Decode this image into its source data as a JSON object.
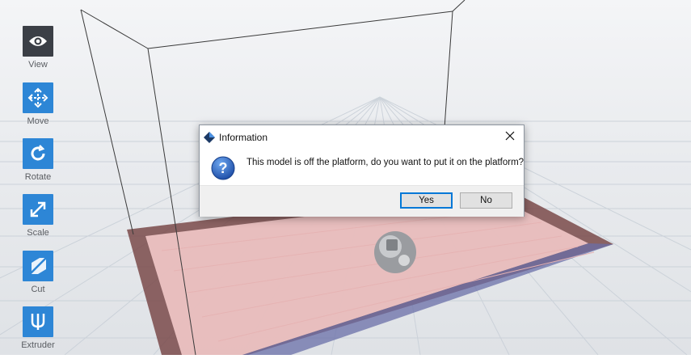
{
  "toolbar": {
    "items": [
      {
        "label": "View",
        "icon": "eye-icon",
        "active": true
      },
      {
        "label": "Move",
        "icon": "move-arrows-icon",
        "active": false
      },
      {
        "label": "Rotate",
        "icon": "rotate-icon",
        "active": false
      },
      {
        "label": "Scale",
        "icon": "scale-arrow-icon",
        "active": false
      },
      {
        "label": "Cut",
        "icon": "cut-icon",
        "active": false
      },
      {
        "label": "Extruder",
        "icon": "extruder-icon",
        "active": false
      }
    ]
  },
  "dialog": {
    "title": "Information",
    "message": "This model is off the platform, do you want to put it on the platform?",
    "yes_label": "Yes",
    "no_label": "No",
    "close_icon": "close-icon",
    "question_icon": "question-icon"
  },
  "colors": {
    "tool_blue": "#2d86d6",
    "tool_active": "#3b3f46",
    "platform_border": "#7a4a4a",
    "platform_fill": "#f2c9c9",
    "platform_blue_edge": "#6a6fa8"
  }
}
